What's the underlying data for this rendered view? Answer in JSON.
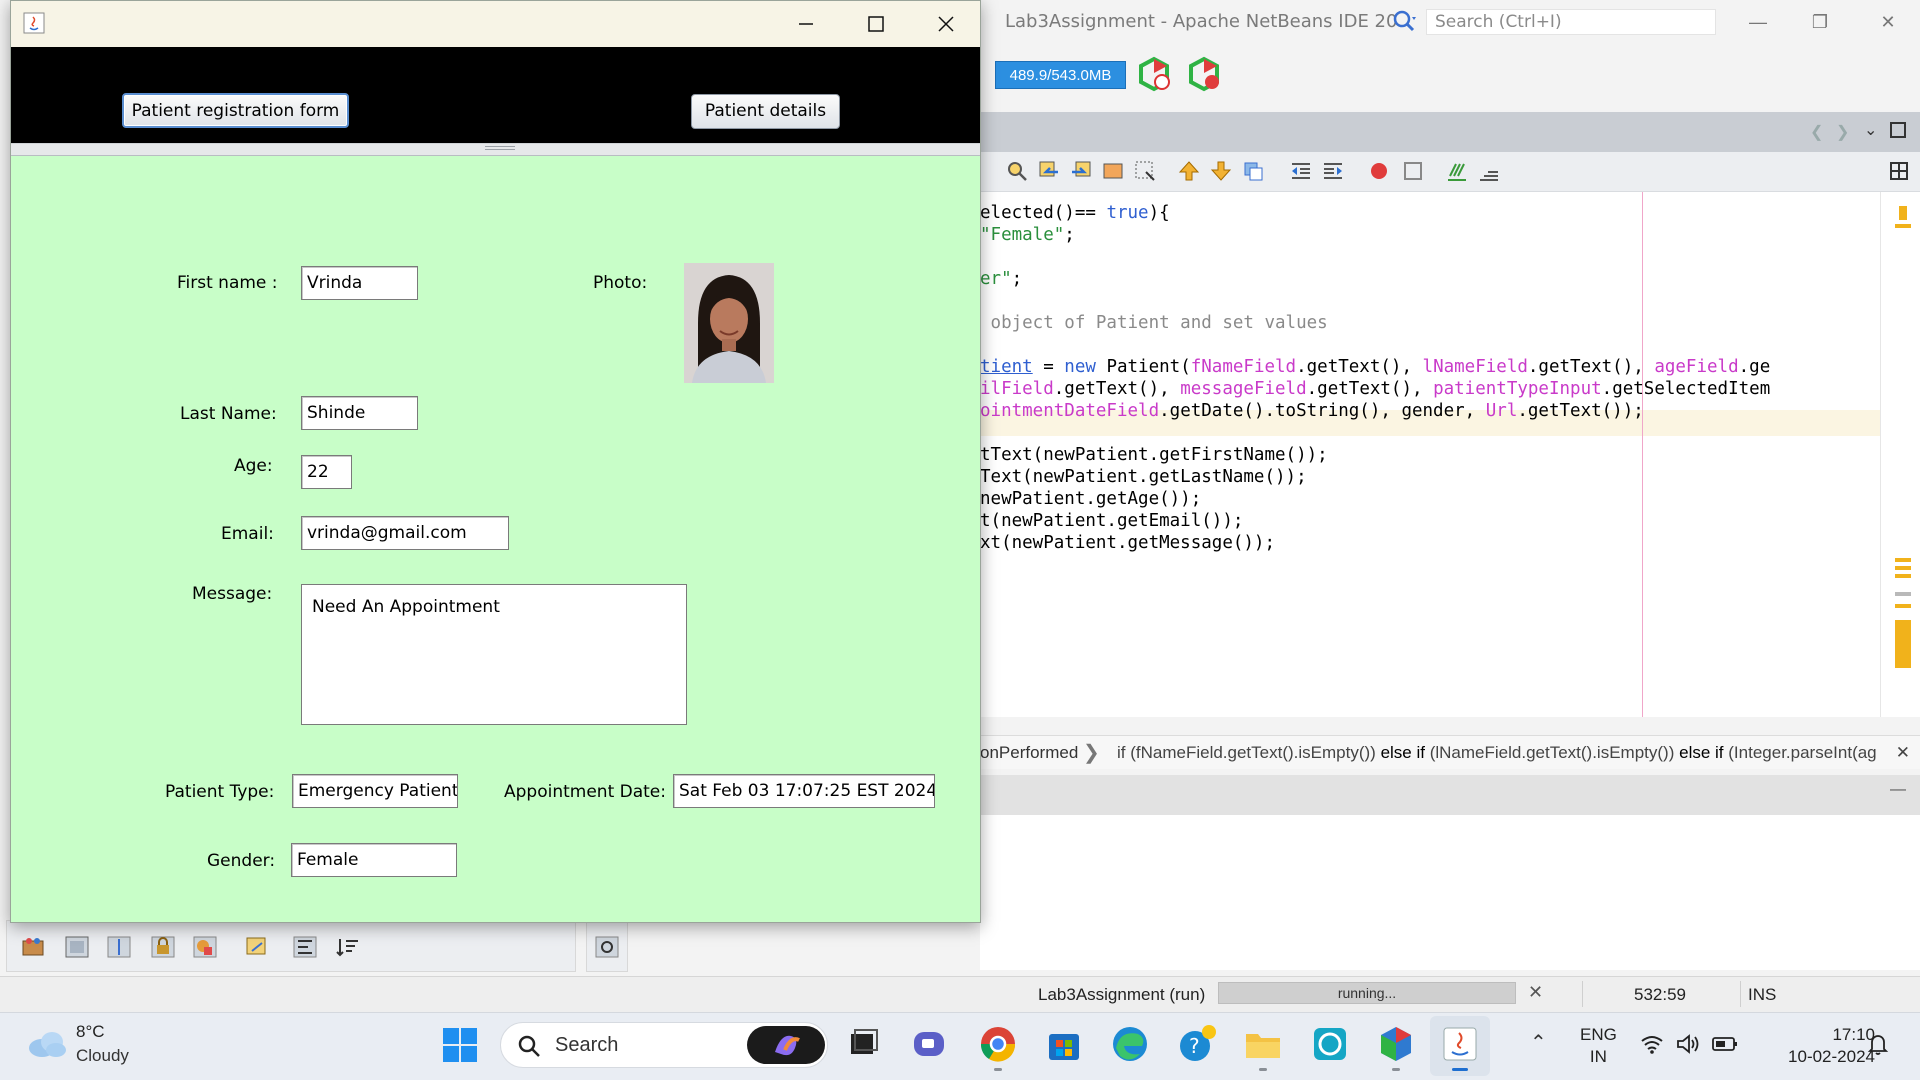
{
  "ide": {
    "title": "Lab3Assignment - Apache NetBeans IDE 20",
    "search_placeholder": "Search (Ctrl+I)",
    "memory": "489.9/543.0MB",
    "code_lines": [
      {
        "segments": [
          {
            "t": "elected()== ",
            "c": ""
          },
          {
            "t": "true",
            "c": "kw"
          },
          {
            "t": "){",
            "c": ""
          }
        ]
      },
      {
        "segments": [
          {
            "t": "\"Female\"",
            "c": "str"
          },
          {
            "t": ";",
            "c": ""
          }
        ]
      },
      {
        "segments": []
      },
      {
        "segments": [
          {
            "t": "er\"",
            "c": "str"
          },
          {
            "t": ";",
            "c": ""
          }
        ]
      },
      {
        "segments": []
      },
      {
        "segments": [
          {
            "t": " object of Patient and set values",
            "c": "cm"
          }
        ]
      },
      {
        "segments": []
      },
      {
        "segments": [
          {
            "t": "tient",
            "c": "link"
          },
          {
            "t": " = ",
            "c": ""
          },
          {
            "t": "new",
            "c": "kw"
          },
          {
            "t": " Patient(",
            "c": ""
          },
          {
            "t": "fNameField",
            "c": "fld"
          },
          {
            "t": ".getText(), ",
            "c": ""
          },
          {
            "t": "lNameField",
            "c": "fld"
          },
          {
            "t": ".getText(), ",
            "c": ""
          },
          {
            "t": "ageField",
            "c": "fld"
          },
          {
            "t": ".ge",
            "c": ""
          }
        ]
      },
      {
        "segments": [
          {
            "t": "ilField",
            "c": "fld"
          },
          {
            "t": ".getText(), ",
            "c": ""
          },
          {
            "t": "messageField",
            "c": "fld"
          },
          {
            "t": ".getText(), ",
            "c": ""
          },
          {
            "t": "patientTypeInput",
            "c": "fld"
          },
          {
            "t": ".getSelectedItem",
            "c": ""
          }
        ]
      },
      {
        "segments": [
          {
            "t": "ointmentDateField",
            "c": "fld"
          },
          {
            "t": ".getDate().toString(), gender, ",
            "c": ""
          },
          {
            "t": "Url",
            "c": "fld"
          },
          {
            "t": ".getText());",
            "c": ""
          }
        ]
      },
      {
        "segments": []
      },
      {
        "segments": [
          {
            "t": "tText(newPatient.getFirstName());",
            "c": ""
          }
        ]
      },
      {
        "segments": [
          {
            "t": "Text(newPatient.getLastName());",
            "c": ""
          }
        ]
      },
      {
        "segments": [
          {
            "t": "newPatient.getAge());",
            "c": ""
          }
        ]
      },
      {
        "segments": [
          {
            "t": "t(newPatient.getEmail());",
            "c": ""
          }
        ]
      },
      {
        "segments": [
          {
            "t": "xt(newPatient.getMessage());",
            "c": ""
          }
        ]
      }
    ],
    "breadcrumb": {
      "method": "onPerformed",
      "path_parts": [
        "if (fNameField.getText().isEmpty())",
        "else if",
        "(lNameField.getText().isEmpty())",
        "else if",
        "(Integer.parseInt(ag"
      ]
    },
    "status": {
      "project": "Lab3Assignment (run)",
      "progress_label": "running...",
      "position": "532:59",
      "mode": "INS"
    }
  },
  "app": {
    "nav": {
      "registration_button": "Patient registration form",
      "details_button": "Patient details"
    },
    "labels": {
      "first_name": "First name :",
      "last_name": "Last Name:",
      "age": "Age:",
      "email": "Email:",
      "message": "Message:",
      "photo": "Photo:",
      "patient_type": "Patient Type:",
      "appointment_date": "Appointment Date:",
      "gender": "Gender:"
    },
    "values": {
      "first_name": "Vrinda",
      "last_name": "Shinde",
      "age": "22",
      "email": "vrinda@gmail.com",
      "message": "Need An Appointment",
      "patient_type": "Emergency Patient",
      "appointment_date": "Sat Feb 03 17:07:25 EST 2024",
      "gender": "Female"
    },
    "colors": {
      "panel_bg": "#c8fec8",
      "top_bar": "#000000"
    }
  },
  "taskbar": {
    "weather_temp": "8°C",
    "weather_cond": "Cloudy",
    "search_label": "Search",
    "lang_line1": "ENG",
    "lang_line2": "IN",
    "time": "17:10",
    "date": "10-02-2024"
  }
}
